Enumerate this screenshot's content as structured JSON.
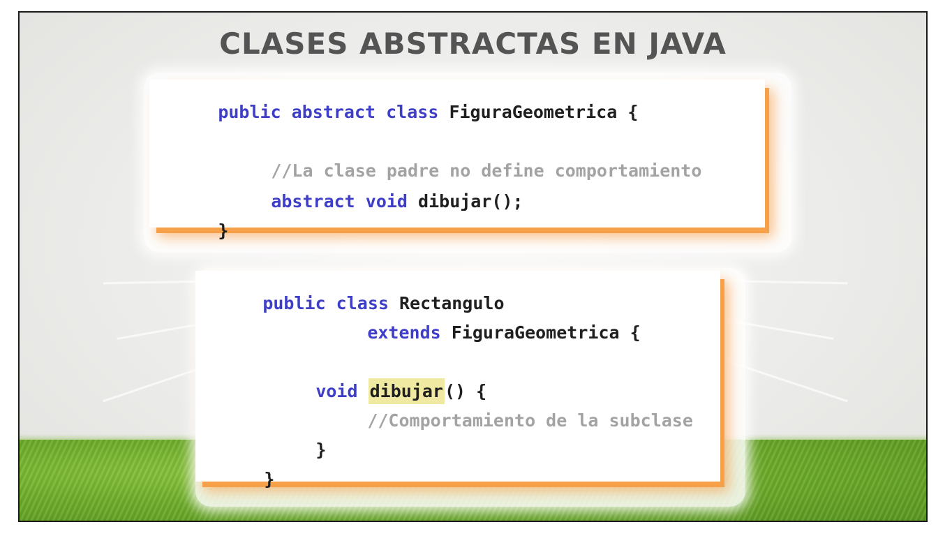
{
  "slide": {
    "title": "CLASES ABSTRACTAS EN JAVA"
  },
  "code_block_1": {
    "line1": {
      "kw": "public abstract class",
      "rest": " FiguraGeometrica {"
    },
    "line3": {
      "comment": "//La clase padre no define comportamiento"
    },
    "line4": {
      "kw": "abstract void",
      "rest": " dibujar();"
    },
    "line5": {
      "rest": "}"
    }
  },
  "code_block_2": {
    "line1": {
      "kw": "public class",
      "rest": " Rectangulo"
    },
    "line2": {
      "kw": "extends",
      "rest": " FiguraGeometrica {"
    },
    "line4": {
      "kw": "void",
      "highlight": "dibujar",
      "rest": "() {"
    },
    "line5": {
      "comment": "//Comportamiento de la subclase"
    },
    "line6": {
      "rest": "}"
    },
    "line7": {
      "rest": "}"
    }
  },
  "colors": {
    "keyword": "#3e3ec8",
    "comment": "#a3a3a3",
    "highlight": "#efe9a2",
    "accent_shadow": "#f7a04a",
    "title": "#545454",
    "grass": "#6fae2a"
  }
}
